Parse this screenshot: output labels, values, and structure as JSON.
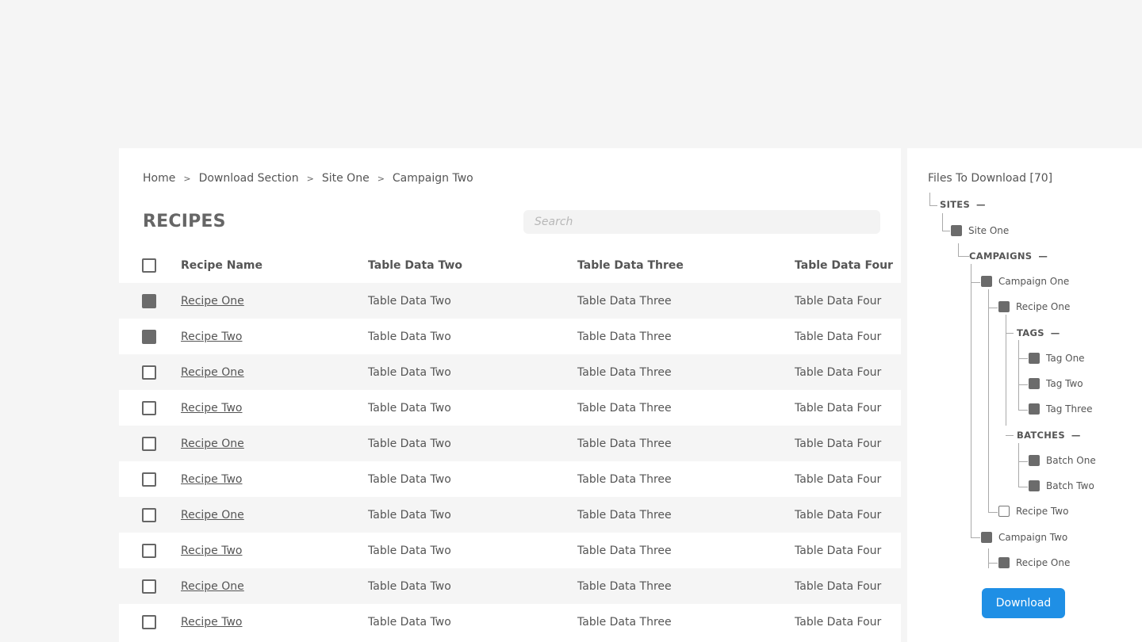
{
  "breadcrumb": {
    "items": [
      "Home",
      "Download Section",
      "Site One",
      "Campaign Two"
    ],
    "separator": ">"
  },
  "page_title": "RECIPES",
  "search": {
    "placeholder": "Search",
    "value": ""
  },
  "table": {
    "headers": [
      "Recipe Name",
      "Table Data Two",
      "Table Data Three",
      "Table Data Four"
    ],
    "rows": [
      {
        "checked": true,
        "name": "Recipe One",
        "c2": "Table Data Two",
        "c3": "Table Data Three",
        "c4": "Table Data Four"
      },
      {
        "checked": true,
        "name": "Recipe Two",
        "c2": "Table Data Two",
        "c3": "Table Data Three",
        "c4": "Table Data Four"
      },
      {
        "checked": false,
        "name": "Recipe One",
        "c2": "Table Data Two",
        "c3": "Table Data Three",
        "c4": "Table Data Four"
      },
      {
        "checked": false,
        "name": "Recipe Two",
        "c2": "Table Data Two",
        "c3": "Table Data Three",
        "c4": "Table Data Four"
      },
      {
        "checked": false,
        "name": "Recipe One",
        "c2": "Table Data Two",
        "c3": "Table Data Three",
        "c4": "Table Data Four"
      },
      {
        "checked": false,
        "name": "Recipe Two",
        "c2": "Table Data Two",
        "c3": "Table Data Three",
        "c4": "Table Data Four"
      },
      {
        "checked": false,
        "name": "Recipe One",
        "c2": "Table Data Two",
        "c3": "Table Data Three",
        "c4": "Table Data Four"
      },
      {
        "checked": false,
        "name": "Recipe Two",
        "c2": "Table Data Two",
        "c3": "Table Data Three",
        "c4": "Table Data Four"
      },
      {
        "checked": false,
        "name": "Recipe One",
        "c2": "Table Data Two",
        "c3": "Table Data Three",
        "c4": "Table Data Four"
      },
      {
        "checked": false,
        "name": "Recipe Two",
        "c2": "Table Data Two",
        "c3": "Table Data Three",
        "c4": "Table Data Four"
      }
    ]
  },
  "files_panel": {
    "title": "Files To Download [70]",
    "collapse_symbol": "—",
    "tree": {
      "sites_label": "SITES",
      "site_one": {
        "label": "Site One",
        "checked": true
      },
      "campaigns_label": "CAMPAIGNS",
      "campaign_one": {
        "label": "Campaign One",
        "checked": true
      },
      "recipe_one": {
        "label": "Recipe One",
        "checked": true
      },
      "tags_label": "TAGS",
      "tag_one": {
        "label": "Tag One",
        "checked": true
      },
      "tag_two": {
        "label": "Tag Two",
        "checked": true
      },
      "tag_three": {
        "label": "Tag Three",
        "checked": true
      },
      "batches_label": "BATCHES",
      "batch_one": {
        "label": "Batch One",
        "checked": true
      },
      "batch_two": {
        "label": "Batch Two",
        "checked": true
      },
      "recipe_two": {
        "label": "Recipe Two",
        "checked": false
      },
      "campaign_two": {
        "label": "Campaign Two",
        "checked": true
      },
      "campaign_two_recipe_one": {
        "label": "Recipe One",
        "checked": true
      }
    },
    "download_label": "Download"
  }
}
